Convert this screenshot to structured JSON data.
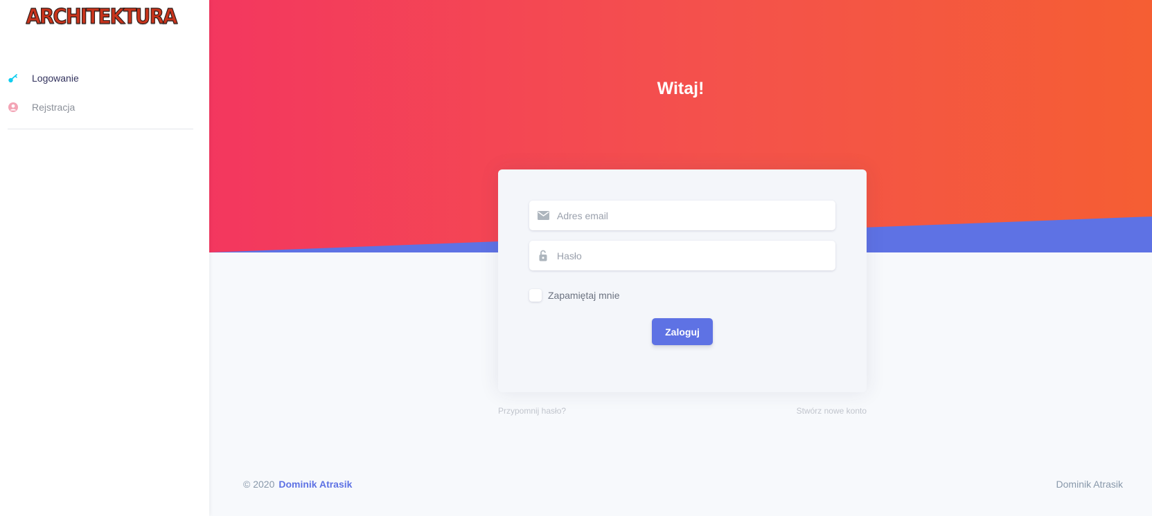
{
  "brand": {
    "logo_text": "ARCHITEKTURA"
  },
  "sidebar": {
    "items": [
      {
        "label": "Logowanie",
        "icon": "key-icon",
        "active": true
      },
      {
        "label": "Rejstracja",
        "icon": "user-circle-icon",
        "active": false
      }
    ]
  },
  "hero": {
    "title": "Witaj!"
  },
  "login_form": {
    "email_placeholder": "Adres email",
    "password_placeholder": "Hasło",
    "remember_label": "Zapamiętaj mnie",
    "submit_label": "Zaloguj"
  },
  "links": {
    "forgot_password": "Przypomnij hasło?",
    "create_account": "Stwórz nowe konto"
  },
  "footer": {
    "copyright": "© 2020",
    "author_link": "Dominik Atrasik",
    "right_text": "Dominik Atrasik"
  },
  "colors": {
    "gradient_start": "#f3375f",
    "gradient_end": "#f55e33",
    "accent": "#5e72e4",
    "icon_cyan": "#11cdef",
    "icon_pink": "#f3a4b5"
  }
}
